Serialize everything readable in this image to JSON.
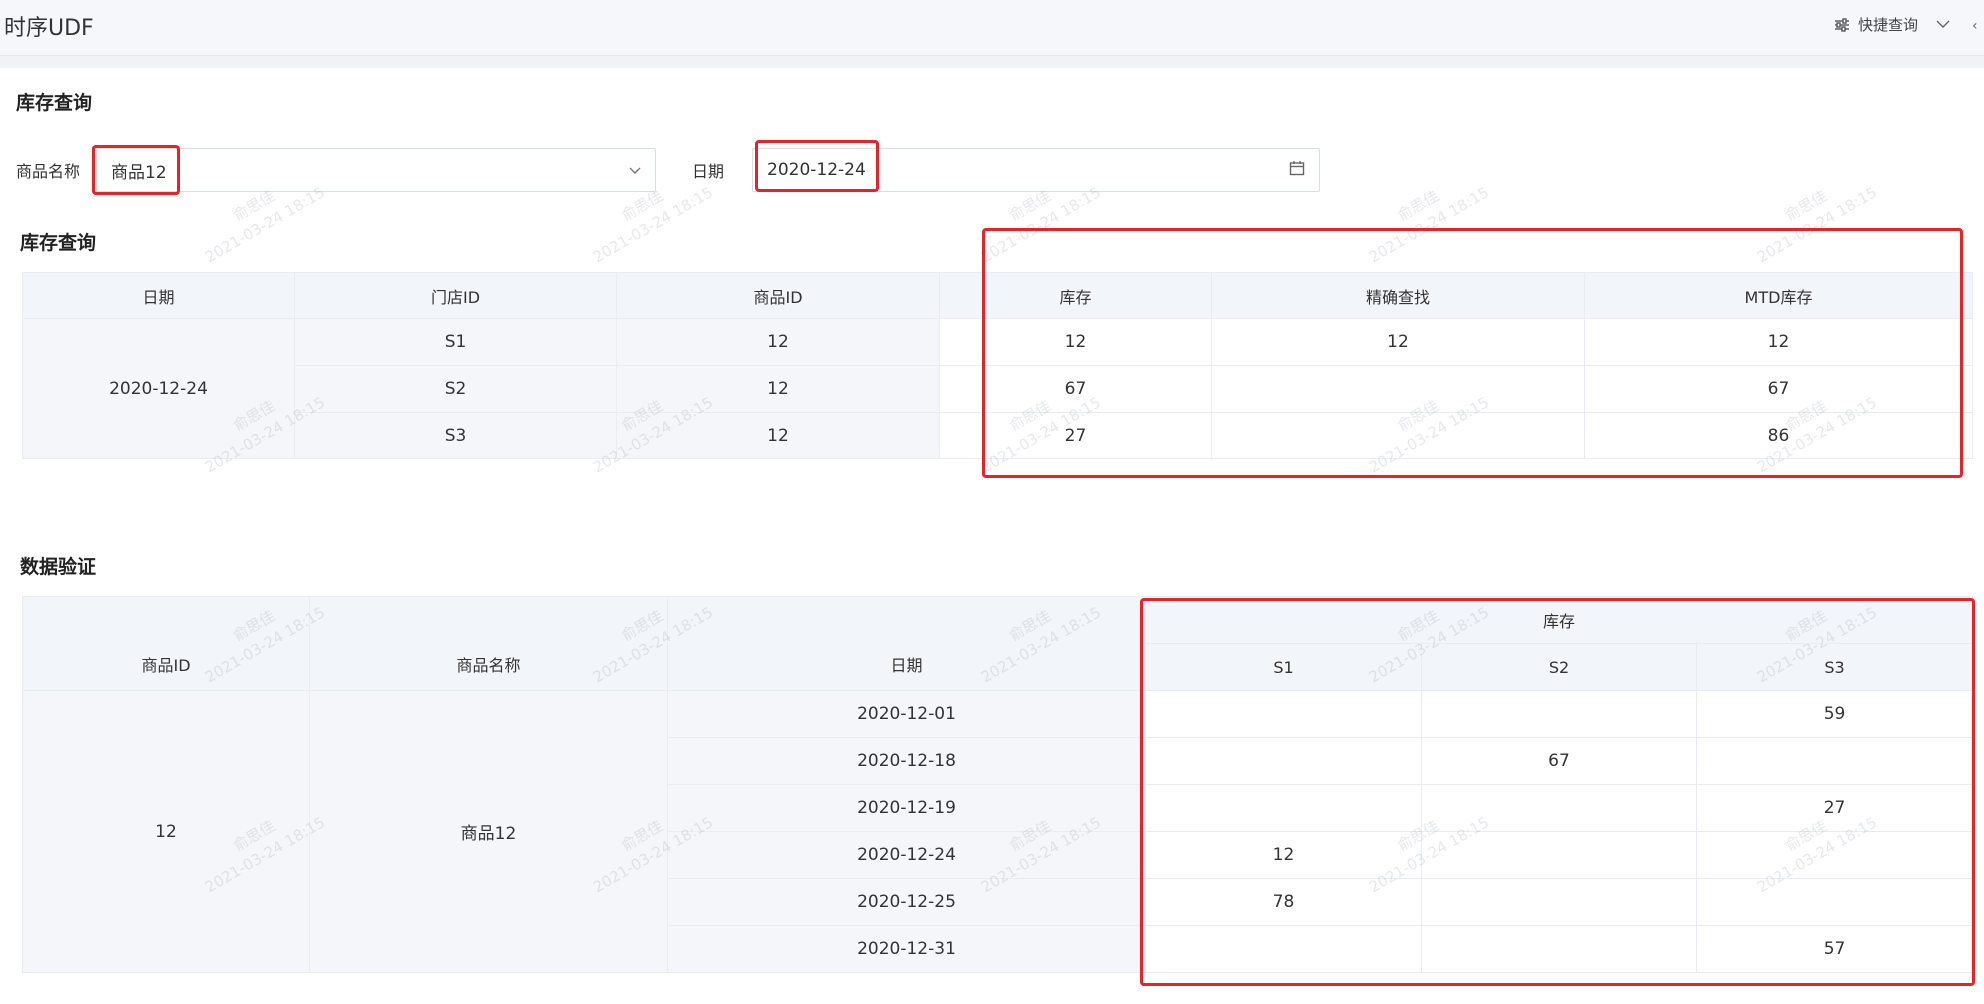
{
  "app": {
    "title": "时序UDF"
  },
  "header": {
    "quick_query_label": "快捷查询"
  },
  "filter": {
    "section_title": "库存查询",
    "product_label": "商品名称",
    "product_value": "商品12",
    "date_label": "日期",
    "date_value": "2020-12-24"
  },
  "inventory": {
    "section_title": "库存查询",
    "columns": [
      "日期",
      "门店ID",
      "商品ID",
      "库存",
      "精确查找",
      "MTD库存"
    ],
    "date": "2020-12-24",
    "rows": [
      {
        "store": "S1",
        "product_id": "12",
        "stock": "12",
        "exact": "12",
        "mtd": "12"
      },
      {
        "store": "S2",
        "product_id": "12",
        "stock": "67",
        "exact": "",
        "mtd": "67"
      },
      {
        "store": "S3",
        "product_id": "12",
        "stock": "27",
        "exact": "",
        "mtd": "86"
      }
    ]
  },
  "validation": {
    "section_title": "数据验证",
    "columns": [
      "商品ID",
      "商品名称",
      "日期"
    ],
    "group_header": "库存",
    "stores": [
      "S1",
      "S2",
      "S3"
    ],
    "product_id": "12",
    "product_name": "商品12",
    "rows": [
      {
        "date": "2020-12-01",
        "s1": "",
        "s2": "",
        "s3": "59"
      },
      {
        "date": "2020-12-18",
        "s1": "",
        "s2": "67",
        "s3": ""
      },
      {
        "date": "2020-12-19",
        "s1": "",
        "s2": "",
        "s3": "27"
      },
      {
        "date": "2020-12-24",
        "s1": "12",
        "s2": "",
        "s3": ""
      },
      {
        "date": "2020-12-25",
        "s1": "78",
        "s2": "",
        "s3": ""
      },
      {
        "date": "2020-12-31",
        "s1": "",
        "s2": "",
        "s3": "57"
      }
    ]
  },
  "watermark": {
    "name": "俞思佳",
    "timestamp": "2021-03-24 18:15"
  },
  "colors": {
    "highlight": "#e0262a",
    "header_bg": "#f2f5f9",
    "panel_bg": "#ffffff",
    "page_bg": "#f0f2f5"
  }
}
